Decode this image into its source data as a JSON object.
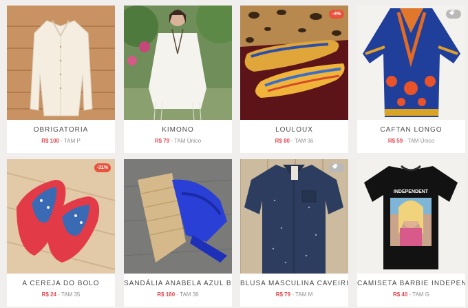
{
  "colors": {
    "price": "#e3474f",
    "discount_badge": "#e7533d",
    "tag_badge": "#b9b9b9"
  },
  "products": [
    {
      "title": "OBRIGATORIA",
      "price": "R$ 100",
      "size": "TAM P",
      "badge": ""
    },
    {
      "title": "KIMONO",
      "price": "R$ 79",
      "size": "TAM Único",
      "badge": ""
    },
    {
      "title": "LOULOUX",
      "price": "R$ 80",
      "size": "TAM 36",
      "badge": "-4%"
    },
    {
      "title": "CAFTAN LONGO",
      "price": "R$ 59",
      "size": "TAM Único",
      "badge": "tag-icon"
    },
    {
      "title": "A CEREJA DO BOLO",
      "price": "R$ 24",
      "size": "TAM 35",
      "badge": "-31%"
    },
    {
      "title": "SANDÁLIA ANABELA AZUL BI",
      "price": "R$ 180",
      "size": "TAM 36",
      "badge": ""
    },
    {
      "title": "BLUSA MASCULINA CAVEIRIN",
      "price": "R$ 79",
      "size": "TAM M",
      "badge": "tag-icon"
    },
    {
      "title": "CAMISETA BARBIE INDEPEND",
      "price": "R$ 40",
      "size": "TAM G",
      "badge": ""
    }
  ],
  "image_text": {
    "tshirt_print": "INDEPENDENT"
  }
}
